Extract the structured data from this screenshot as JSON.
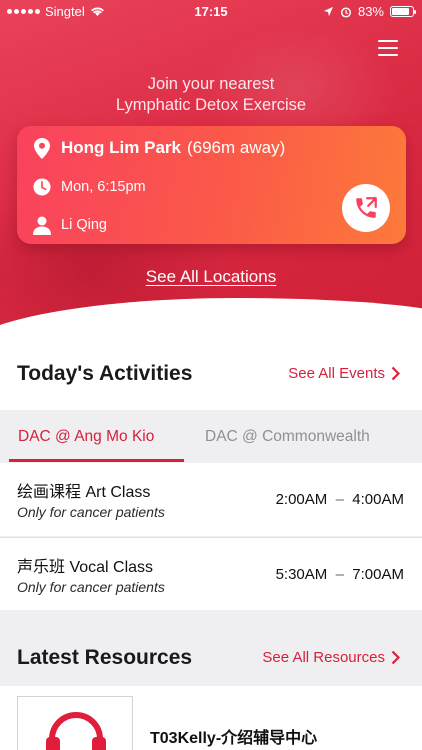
{
  "status_bar": {
    "carrier": "Singtel",
    "time": "17:15",
    "battery": "83%",
    "battery_level": 0.83
  },
  "hero": {
    "title_line1": "Join your nearest",
    "title_line2": "Lymphatic Detox Exercise",
    "location": {
      "place": "Hong Lim Park",
      "distance": "(696m away)",
      "schedule": "Mon, 6:15pm",
      "instructor": "Li Qing"
    },
    "see_all_locations": "See All Locations"
  },
  "activities": {
    "heading": "Today's Activities",
    "see_all": "See All Events",
    "tabs": [
      {
        "label": "DAC @ Ang Mo Kio",
        "active": true
      },
      {
        "label": "DAC @ Commonwealth",
        "active": false
      }
    ],
    "items": [
      {
        "name": "绘画课程 Art Class",
        "note": "Only for cancer patients",
        "start": "2:00AM",
        "end": "4:00AM"
      },
      {
        "name": "声乐班 Vocal Class",
        "note": "Only for cancer patients",
        "start": "5:30AM",
        "end": "7:00AM"
      }
    ]
  },
  "resources": {
    "heading": "Latest Resources",
    "see_all": "See All Resources",
    "items": [
      {
        "title": "T03Kelly-介绍辅导中心",
        "icon": "headphones-icon"
      }
    ]
  },
  "colors": {
    "accent": "#d8203c",
    "hero": "#dc2c45",
    "card_start": "#f9425e",
    "card_end": "#fd7a3a"
  }
}
